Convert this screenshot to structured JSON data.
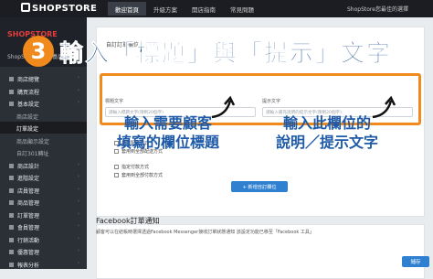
{
  "topbar": {
    "logo": "SHOPSTORE",
    "nav": [
      "歡迎首頁",
      "升級方案",
      "開店指南",
      "常見問題"
    ],
    "active_index": 0,
    "right_text": "ShopStore您最佳的選擇"
  },
  "sidebar": {
    "brand_logo": "SHOPSTORE",
    "brand_name": "ShopStore美容保養品",
    "items": [
      {
        "label": "商店總覽",
        "type": "section",
        "icon": "home-icon"
      },
      {
        "label": "購買流程",
        "type": "section",
        "icon": "cart-icon"
      },
      {
        "label": "基本設定",
        "type": "section",
        "icon": "settings-icon"
      },
      {
        "label": "商店設定",
        "type": "sub"
      },
      {
        "label": "訂單設定",
        "type": "sub",
        "current": true
      },
      {
        "label": "商品顯示設定",
        "type": "sub"
      },
      {
        "label": "自訂301轉址",
        "type": "sub"
      },
      {
        "label": "商店設計",
        "type": "section",
        "icon": "design-icon"
      },
      {
        "label": "進階設定",
        "type": "section",
        "icon": "advanced-icon"
      },
      {
        "label": "店員管理",
        "type": "section",
        "icon": "staff-icon"
      },
      {
        "label": "商品管理",
        "type": "section",
        "icon": "product-icon"
      },
      {
        "label": "訂單管理",
        "type": "section",
        "icon": "order-icon"
      },
      {
        "label": "會員管理",
        "type": "section",
        "icon": "member-icon"
      },
      {
        "label": "行銷活動",
        "type": "section",
        "icon": "marketing-icon"
      },
      {
        "label": "優惠管理",
        "type": "section",
        "icon": "coupon-icon"
      },
      {
        "label": "報表分析",
        "type": "section",
        "icon": "report-icon"
      }
    ]
  },
  "main": {
    "card_title": "自訂訂單欄位",
    "field_title": {
      "label": "標題文字",
      "placeholder": "請輸入標題文字(限制20個字)"
    },
    "field_hint": {
      "label": "提示文字",
      "placeholder": "請輸入補充說明的提示文字(限制20個字)"
    },
    "checks": [
      {
        "label": "指定配送方式"
      },
      {
        "label": "套用到全部配送方式"
      },
      {
        "label": "指定付款方式"
      },
      {
        "label": "套用到全部付款方式"
      }
    ],
    "add_button": "+ 新增自訂欄位",
    "facebook": {
      "title": "Facebook訂單通知",
      "desc": "顧客可以在結帳時選擇透過Facebook Messenger接收訂單狀態通知 該設定功能已移至「Facebook 工具」"
    },
    "save_button": "儲存"
  },
  "annotation": {
    "number": "3",
    "title": "輸入「標題」與「提示」文字",
    "left_note": "輸入需要顧客\n填寫的欄位標題",
    "right_note": "輸入此欄位的\n說明／提示文字",
    "accent": "#f08a1c",
    "text_color": "#1e5aa8"
  }
}
